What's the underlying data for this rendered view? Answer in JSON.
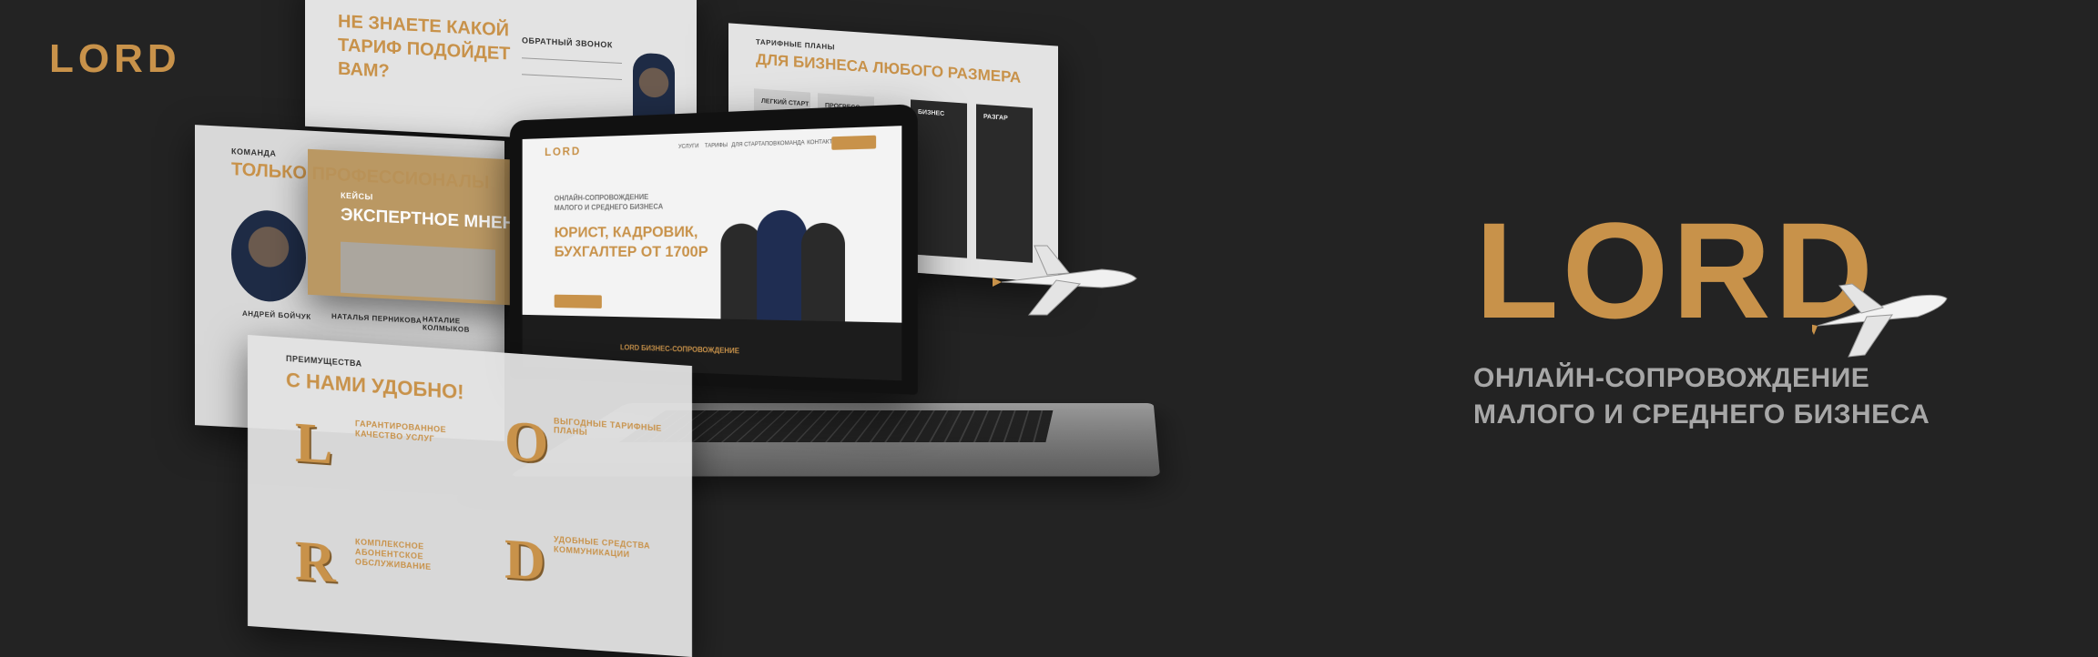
{
  "brand": {
    "logo_small": "LORD",
    "logo_large": "LORD",
    "color_gold": "#c8924a",
    "color_background": "#232323"
  },
  "tagline": {
    "line1": "ОНЛАЙН-СОПРОВОЖДЕНИЕ",
    "line2": "МАЛОГО И СРЕДНЕГО БИЗНЕСА"
  },
  "panels": {
    "callback": {
      "title": "НЕ ЗНАЕТЕ КАКОЙ ТАРИФ ПОДОЙДЕТ ВАМ?",
      "form_label": "ОБРАТНЫЙ ЗВОНОК"
    },
    "tariffs": {
      "label": "ТАРИФНЫЕ ПЛАНЫ",
      "title": "ДЛЯ БИЗНЕСА ЛЮБОГО РАЗМЕРА",
      "plans": [
        "ЛЕГКИЙ СТАРТ",
        "ПРОГРЕСС",
        "БИЗНЕС",
        "РАЗГАР"
      ]
    },
    "team": {
      "label": "КОМАНДА",
      "title": "ТОЛЬКО ПРОФЕССИОНАЛЫ",
      "members": [
        "АНДРЕЙ БОЙЧУК",
        "НАТАЛЬЯ ПЕРНИКОВА",
        "НАТАЛИЕ КОЛМЫКОВ"
      ]
    },
    "cases": {
      "label": "КЕЙСЫ",
      "title": "ЭКСПЕРТНОЕ МНЕН"
    },
    "advantages": {
      "label": "ПРЕИМУЩЕСТВА",
      "title": "С НАМИ УДОБНО!",
      "items": [
        "ГАРАНТИРОВАННОЕ КАЧЕСТВО УСЛУГ",
        "ВЫГОДНЫЕ ТАРИФНЫЕ ПЛАНЫ",
        "КОМПЛЕКСНОЕ АБОНЕНТСКОЕ ОБСЛУЖИВАНИЕ",
        "УДОБНЫЕ СРЕДСТВА КОММУНИКАЦИИ"
      ],
      "letters": [
        "L",
        "O",
        "R",
        "D"
      ]
    }
  },
  "laptop": {
    "logo": "LORD",
    "nav": [
      "УСЛУГИ",
      "ТАРИФЫ",
      "ДЛЯ СТАРТАПОВ",
      "КОМАНДА",
      "КОНТАКТЫ"
    ],
    "subtitle_line1": "ОНЛАЙН-СОПРОВОЖДЕНИЕ",
    "subtitle_line2": "МАЛОГО И СРЕДНЕГО БИЗНЕСА",
    "headline_line1": "ЮРИСТ, КАДРОВИК,",
    "headline_line2": "БУХГАЛТЕР ОТ 1700Р",
    "footer_title": "LORD БИЗНЕС-СОПРОВОЖДЕНИЕ"
  }
}
